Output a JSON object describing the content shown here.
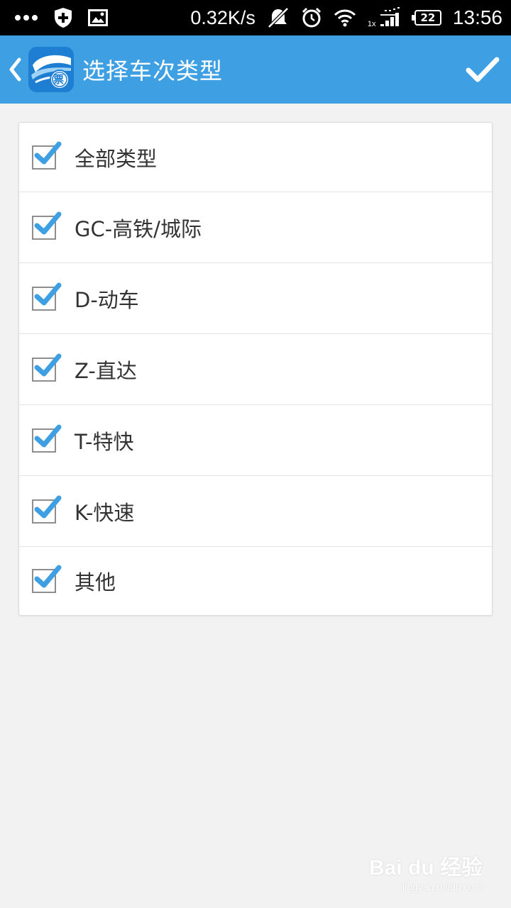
{
  "status_bar": {
    "net_speed": "0.32K/s",
    "sim_label": "1x",
    "battery": "22",
    "time": "13:56"
  },
  "header": {
    "title": "选择车次类型",
    "logo_text": "票",
    "accent_color": "#3ea0e3"
  },
  "options": [
    {
      "label": "全部类型",
      "checked": true
    },
    {
      "label": "GC-高铁/城际",
      "checked": true
    },
    {
      "label": "D-动车",
      "checked": true
    },
    {
      "label": "Z-直达",
      "checked": true
    },
    {
      "label": "T-特快",
      "checked": true
    },
    {
      "label": "K-快速",
      "checked": true
    },
    {
      "label": "其他",
      "checked": true
    }
  ],
  "watermark": {
    "brand": "Bai du 经验",
    "url": "jingyan.baidu.com"
  }
}
